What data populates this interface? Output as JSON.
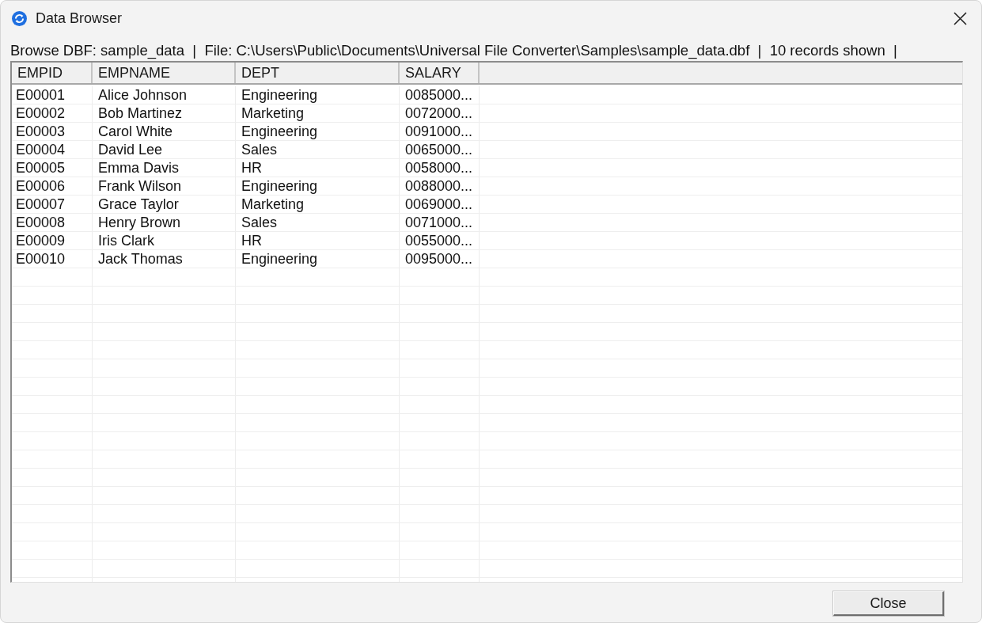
{
  "window": {
    "title": "Data Browser"
  },
  "info_line": "Browse DBF: sample_data  |  File: C:\\Users\\Public\\Documents\\Universal File Converter\\Samples\\sample_data.dbf  |  10 records shown  |",
  "table": {
    "columns": [
      "EMPID",
      "EMPNAME",
      "DEPT",
      "SALARY"
    ],
    "rows": [
      [
        "E00001",
        "Alice Johnson",
        "Engineering",
        "0085000..."
      ],
      [
        "E00002",
        "Bob Martinez",
        "Marketing",
        "0072000..."
      ],
      [
        "E00003",
        "Carol White",
        "Engineering",
        "0091000..."
      ],
      [
        "E00004",
        "David Lee",
        "Sales",
        "0065000..."
      ],
      [
        "E00005",
        "Emma Davis",
        "HR",
        "0058000..."
      ],
      [
        "E00006",
        "Frank Wilson",
        "Engineering",
        "0088000..."
      ],
      [
        "E00007",
        "Grace Taylor",
        "Marketing",
        "0069000..."
      ],
      [
        "E00008",
        "Henry Brown",
        "Sales",
        "0071000..."
      ],
      [
        "E00009",
        "Iris Clark",
        "HR",
        "0055000..."
      ],
      [
        "E00010",
        "Jack Thomas",
        "Engineering",
        "0095000..."
      ]
    ]
  },
  "buttons": [
    "Close"
  ]
}
